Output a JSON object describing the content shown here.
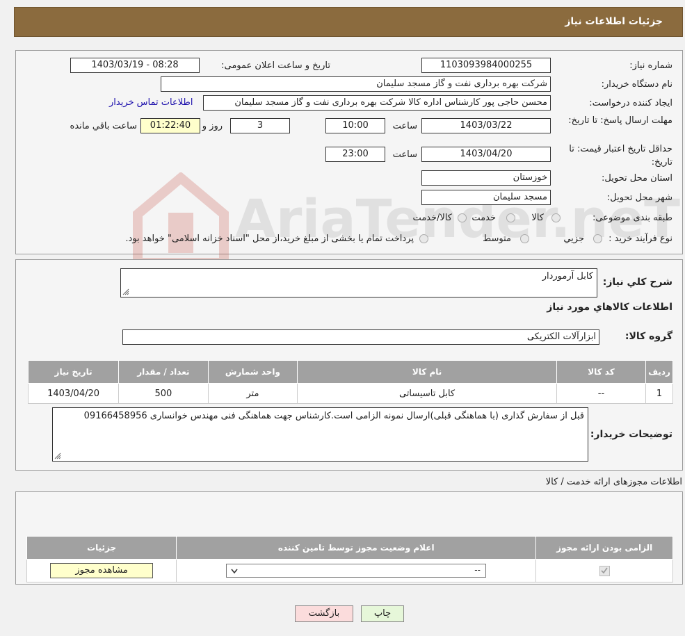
{
  "header": {
    "title": "جزئیات اطلاعات نیاز"
  },
  "info": {
    "need_number_label": "شماره نیاز:",
    "need_number": "1103093984000255",
    "announce_label": "تاریخ و ساعت اعلان عمومی:",
    "announce_value": "1403/03/19 - 08:28",
    "buyer_org_label": "نام دستگاه خریدار:",
    "buyer_org": "شرکت بهره برداری نفت و گاز مسجد سلیمان",
    "requester_label": "ایجاد کننده درخواست:",
    "requester": "محسن حاجی پور کارشناس اداره کالا  شرکت بهره برداری نفت و گاز مسجد سلیمان",
    "contact_link": "اطلاعات تماس خریدار",
    "deadline_label": "مهلت ارسال پاسخ: تا تاریخ:",
    "deadline_date": "1403/03/22",
    "time_label": "ساعت",
    "deadline_time": "10:00",
    "days_value": "3",
    "days_label": "روز و",
    "remaining_value": "01:22:40",
    "remaining_label": "ساعت باقي مانده",
    "validity_label": "حداقل تاریخ اعتبار قیمت: تا تاریخ:",
    "validity_date": "1403/04/20",
    "validity_time": "23:00",
    "province_label": "استان محل تحویل:",
    "province": "خوزستان",
    "city_label": "شهر محل تحویل:",
    "city": "مسجد سلیمان",
    "category_label": "طبقه بندی موضوعی:",
    "category_options": [
      "کالا",
      "خدمت",
      "کالا/خدمت"
    ],
    "process_label": "نوع فرآیند خرید :",
    "process_options": [
      "جزیي",
      "متوسط"
    ],
    "process_note": "پرداخت تمام یا بخشی از مبلغ خرید،از محل \"اسناد خزانه اسلامی\" خواهد بود."
  },
  "details": {
    "summary_label": "شرح کلي نياز:",
    "summary_value": "کابل آرموردار",
    "goods_title": "اطلاعات کالاهاي مورد نياز",
    "group_label": "گروه کالا:",
    "group_value": "ابزارآلات الکتریکی",
    "table_headers": [
      "رديف",
      "کد کالا",
      "نام کالا",
      "واحد شمارش",
      "تعداد / مقدار",
      "تاریخ نیاز"
    ],
    "table_rows": [
      [
        "1",
        "--",
        "کابل تاسیساتی",
        "متر",
        "500",
        "1403/04/20"
      ]
    ],
    "notes_label": "توضیحات خریدار:",
    "notes_value": "قبل از سفارش گذاری (با هماهنگی قبلی)ارسال نمونه الزامی است.کارشناس جهت هماهنگی فنی مهندس خوانساری 09166458956"
  },
  "permits": {
    "section_title": "اطلاعات مجوزهای ارائه خدمت / کالا",
    "headers": [
      "الزامی بودن ارائه مجوز",
      "اعلام وضعیت مجوز توسط تامین کننده",
      "جزئیات"
    ],
    "select_value": "--",
    "view_button": "مشاهده مجوز"
  },
  "footer": {
    "print_button": "چاپ",
    "back_button": "بازگشت"
  },
  "watermark": {
    "text": "AriaTender.neT"
  }
}
